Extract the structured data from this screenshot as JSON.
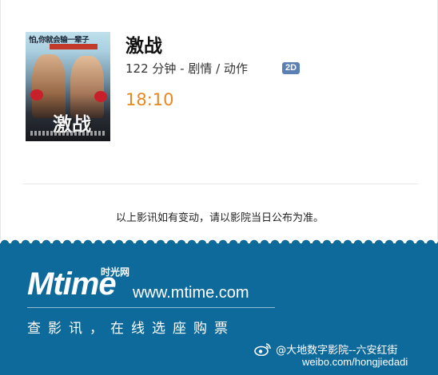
{
  "movie": {
    "poster_tagline": "怕,你就会输一辈子",
    "poster_title": "激战",
    "title": "激战",
    "duration": "122 分钟 - 剧情 / 动作",
    "format_badge": "2D",
    "showtime": "18:10"
  },
  "notice": "以上影讯如有变动，请以影院当日公布为准。",
  "footer": {
    "logo_text": "Mtime",
    "logo_cn": "时光网",
    "url": "www.mtime.com",
    "slogan": "查影讯，在线选座购票",
    "weibo_handle": "@大地数字影院--六安红街",
    "weibo_url": "weibo.com/hongjiedadi",
    "background_color": "#0f6a9c",
    "accent_color": "#e8871e"
  }
}
